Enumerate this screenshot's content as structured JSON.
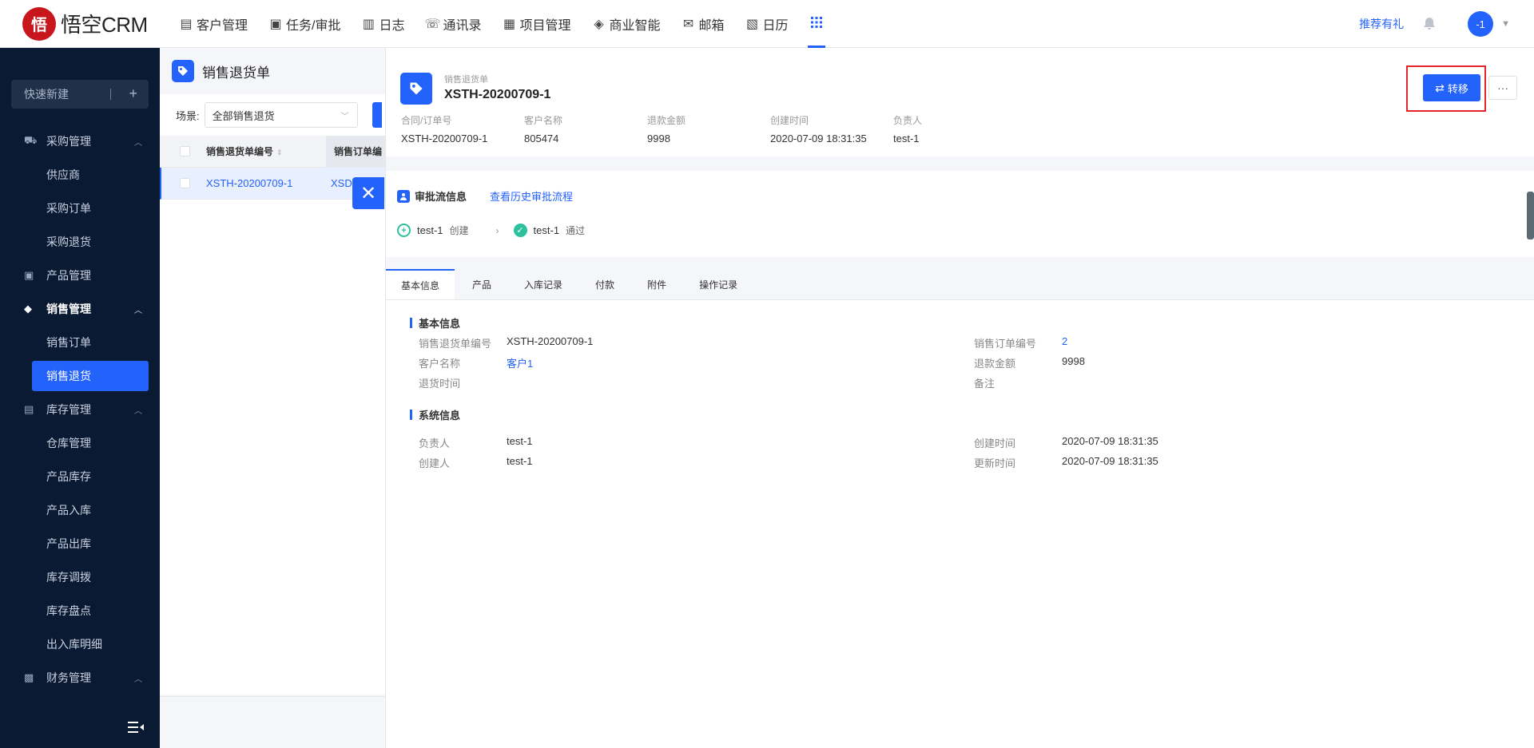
{
  "brand": {
    "logo_glyph": "悟",
    "name": "悟空CRM",
    "accent": "#2362fb"
  },
  "topnav": {
    "items": [
      {
        "icon": "building-icon",
        "glyph": "▤",
        "label": "客户管理"
      },
      {
        "icon": "briefcase-icon",
        "glyph": "▣",
        "label": "任务/审批"
      },
      {
        "icon": "log-icon",
        "glyph": "▥",
        "label": "日志"
      },
      {
        "icon": "phone-book-icon",
        "glyph": "☏",
        "label": "通讯录"
      },
      {
        "icon": "project-icon",
        "glyph": "▦",
        "label": "项目管理"
      },
      {
        "icon": "bi-icon",
        "glyph": "◈",
        "label": "商业智能"
      },
      {
        "icon": "mail-icon",
        "glyph": "✉",
        "label": "邮箱"
      },
      {
        "icon": "calendar-icon",
        "glyph": "▧",
        "label": "日历"
      }
    ],
    "apps_icon": "apps-grid-icon",
    "recommend": "推荐有礼",
    "avatar_text": "-1"
  },
  "sidebar": {
    "quick_new": "快速新建",
    "groups": [
      {
        "label": "采购管理",
        "icon": "cart-icon",
        "glyph": "🛒",
        "items": [
          "供应商",
          "采购订单",
          "采购退货"
        ]
      },
      {
        "label": "产品管理",
        "icon": "box-icon",
        "glyph": "▨",
        "items": []
      },
      {
        "label": "销售管理",
        "icon": "tag-icon",
        "glyph": "◆",
        "items": [
          "销售订单",
          "销售退货"
        ]
      },
      {
        "label": "库存管理",
        "icon": "warehouse-icon",
        "glyph": "▤",
        "items": [
          "仓库管理",
          "产品库存",
          "产品入库",
          "产品出库",
          "库存调拨",
          "库存盘点",
          "出入库明细"
        ]
      },
      {
        "label": "财务管理",
        "icon": "wallet-icon",
        "glyph": "▩",
        "items": []
      }
    ],
    "active_item": "销售退货"
  },
  "list": {
    "title": "销售退货单",
    "scene_label": "场景:",
    "scene_value": "全部销售退货",
    "columns": [
      "销售退货单编号",
      "销售订单编"
    ],
    "rows": [
      {
        "no": "XSTH-20200709-1",
        "order": "XSD"
      }
    ]
  },
  "detail": {
    "type_label": "销售退货单",
    "title": "XSTH-20200709-1",
    "fields": [
      {
        "k": "合同/订单号",
        "v": "XSTH-20200709-1"
      },
      {
        "k": "客户名称",
        "v": "805474"
      },
      {
        "k": "退款金额",
        "v": "9998"
      },
      {
        "k": "创建时间",
        "v": "2020-07-09 18:31:35"
      },
      {
        "k": "负责人",
        "v": "test-1"
      }
    ],
    "transfer_label": "转移",
    "more_label": "···",
    "approval": {
      "title": "审批流信息",
      "history_link": "查看历史审批流程",
      "steps": [
        {
          "name": "test-1",
          "action": "创建"
        },
        {
          "name": "test-1",
          "action": "通过"
        }
      ]
    },
    "tabs": [
      "基本信息",
      "产品",
      "入库记录",
      "付款",
      "附件",
      "操作记录"
    ],
    "basic": {
      "title": "基本信息",
      "left": [
        {
          "k": "销售退货单编号",
          "v": "XSTH-20200709-1"
        },
        {
          "k": "客户名称",
          "v": "客户1"
        },
        {
          "k": "退货时间",
          "v": ""
        }
      ],
      "right": [
        {
          "k": "销售订单编号",
          "v": "2"
        },
        {
          "k": "退款金额",
          "v": "9998"
        },
        {
          "k": "备注",
          "v": ""
        }
      ]
    },
    "system": {
      "title": "系统信息",
      "left": [
        {
          "k": "负责人",
          "v": "test-1"
        },
        {
          "k": "创建人",
          "v": "test-1"
        }
      ],
      "right": [
        {
          "k": "创建时间",
          "v": "2020-07-09 18:31:35"
        },
        {
          "k": "更新时间",
          "v": "2020-07-09 18:31:35"
        }
      ]
    }
  }
}
